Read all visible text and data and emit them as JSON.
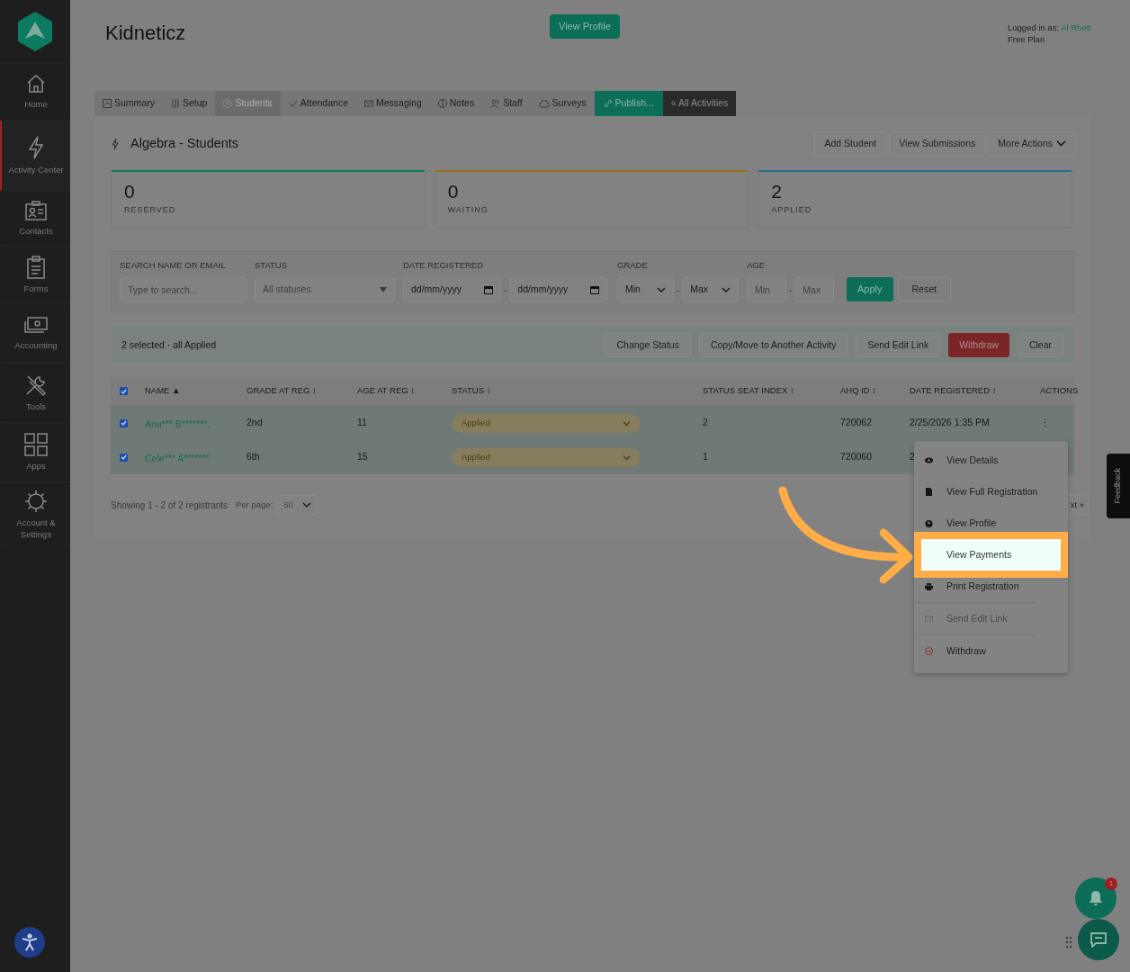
{
  "sidebar": {
    "items": [
      {
        "label": "Home",
        "selected": false
      },
      {
        "label": "Activity Center",
        "selected": true
      },
      {
        "label": "Contacts",
        "selected": false
      },
      {
        "label": "Forms",
        "selected": false
      },
      {
        "label": "Accounting",
        "selected": false
      },
      {
        "label": "Tools",
        "selected": false
      },
      {
        "label": "Apps",
        "selected": false
      },
      {
        "label": "Account & Settings",
        "selected": false
      }
    ]
  },
  "header": {
    "title": "Kidneticz",
    "button": "View Profile",
    "logged_in_label": "Logged in as:",
    "user": "Al Rhett",
    "plan": "Free Plan"
  },
  "tabs": [
    {
      "label": "Summary",
      "kind": "tab",
      "selected": false
    },
    {
      "label": "Setup",
      "kind": "tab",
      "selected": false
    },
    {
      "label": "Students",
      "kind": "tab",
      "selected": true
    },
    {
      "label": "Attendance",
      "kind": "tab",
      "selected": false
    },
    {
      "label": "Messaging",
      "kind": "tab",
      "selected": false
    },
    {
      "label": "Notes",
      "kind": "tab",
      "selected": false
    },
    {
      "label": "Staff",
      "kind": "tab",
      "selected": false
    },
    {
      "label": "Surveys",
      "kind": "tab",
      "selected": false
    },
    {
      "label": "Publish...",
      "kind": "publish",
      "selected": false
    },
    {
      "label": "« All Activities",
      "kind": "back",
      "selected": false
    }
  ],
  "panel": {
    "title": "Algebra - Students",
    "actions": [
      "Add Student",
      "View Submissions",
      "More Actions"
    ]
  },
  "stats": [
    {
      "value": "0",
      "label": "RESERVED",
      "color": "#0c7a60"
    },
    {
      "value": "0",
      "label": "WAITING",
      "color": "#9a6a20"
    },
    {
      "value": "2",
      "label": "APPLIED",
      "color": "#2a6c8a"
    }
  ],
  "filters": {
    "search_label": "SEARCH NAME OR EMAIL",
    "search_placeholder": "Type to search...",
    "status_label": "STATUS",
    "status_value": "All statuses",
    "date_label": "DATE REGISTERED",
    "date_from": "dd/mm/yyyy",
    "date_to": "dd/mm/yyyy",
    "grade_label": "GRADE",
    "grade_min": "Min",
    "grade_max": "Max",
    "age_label": "AGE",
    "age_min_placeholder": "Min",
    "age_max_placeholder": "Max",
    "range_separator": "-",
    "apply": "Apply",
    "reset": "Reset"
  },
  "selection_bar": {
    "text": "2 selected · all Applied",
    "buttons": [
      {
        "label": "Change Status",
        "kind": "plain"
      },
      {
        "label": "Copy/Move to Another Activity",
        "kind": "plain"
      },
      {
        "label": "Send Edit Link",
        "kind": "plain"
      },
      {
        "label": "Withdraw",
        "kind": "danger"
      },
      {
        "label": "Clear",
        "kind": "plain"
      }
    ]
  },
  "table": {
    "all_checked": true,
    "columns": [
      "NAME ▲",
      "GRADE AT REG ↕",
      "AGE AT REG ↕",
      "STATUS ↕",
      "STATUS SEAT INDEX ↕",
      "AHQ ID ↕",
      "DATE REGISTERED ↕",
      "ACTIONS"
    ],
    "rows": [
      {
        "checked": true,
        "name": "Anu*** B*******.",
        "grade": "2nd",
        "age": "11",
        "status": "Applied",
        "seat_index": "2",
        "ahq_id": "720062",
        "date": "2/25/2026 1:35 PM",
        "actions": "⋮"
      },
      {
        "checked": true,
        "name": "Cele*** A*******.",
        "grade": "6th",
        "age": "15",
        "status": "Applied",
        "seat_index": "1",
        "ahq_id": "720060",
        "date": "2"
      }
    ]
  },
  "footer": {
    "showing": "Showing 1 - 2 of 2 registrants",
    "per_page_label": "Per page:",
    "per_page": "50",
    "next": "xt »"
  },
  "menu": {
    "items": [
      {
        "label": "View Details",
        "kind": "item",
        "disabled": false,
        "selected": false
      },
      {
        "label": "View Full Registration",
        "kind": "item",
        "disabled": false,
        "selected": false
      },
      {
        "label": "View Profile",
        "kind": "item",
        "disabled": false,
        "selected": false
      },
      {
        "label": "View Payments",
        "kind": "item",
        "disabled": false,
        "selected": true
      },
      {
        "label": "Print Registration",
        "kind": "item",
        "disabled": false,
        "selected": false
      },
      {
        "label": "Send Edit Link",
        "kind": "item",
        "disabled": true,
        "selected": false
      },
      {
        "label": "Withdraw",
        "kind": "danger",
        "disabled": false,
        "selected": false
      }
    ]
  },
  "feedback": "Feedback",
  "notifications": {
    "count": "1"
  }
}
